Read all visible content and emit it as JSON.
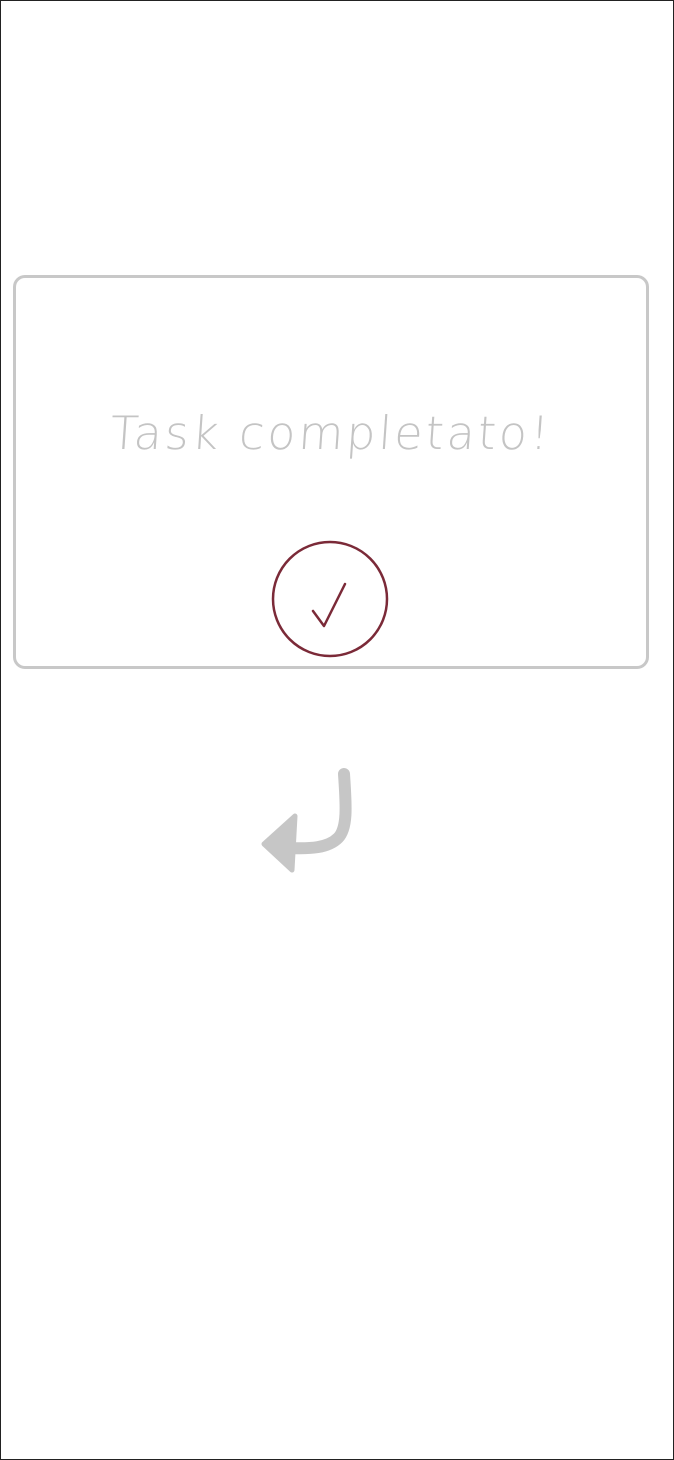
{
  "dialog": {
    "message": "Task completato!"
  },
  "icons": {
    "confirm": "check-icon",
    "back": "return-arrow-icon"
  },
  "colors": {
    "accent": "#7b2a38",
    "outline": "#c8c8c8",
    "text": "#c4c4c4",
    "arrow": "#c6c6c6"
  }
}
